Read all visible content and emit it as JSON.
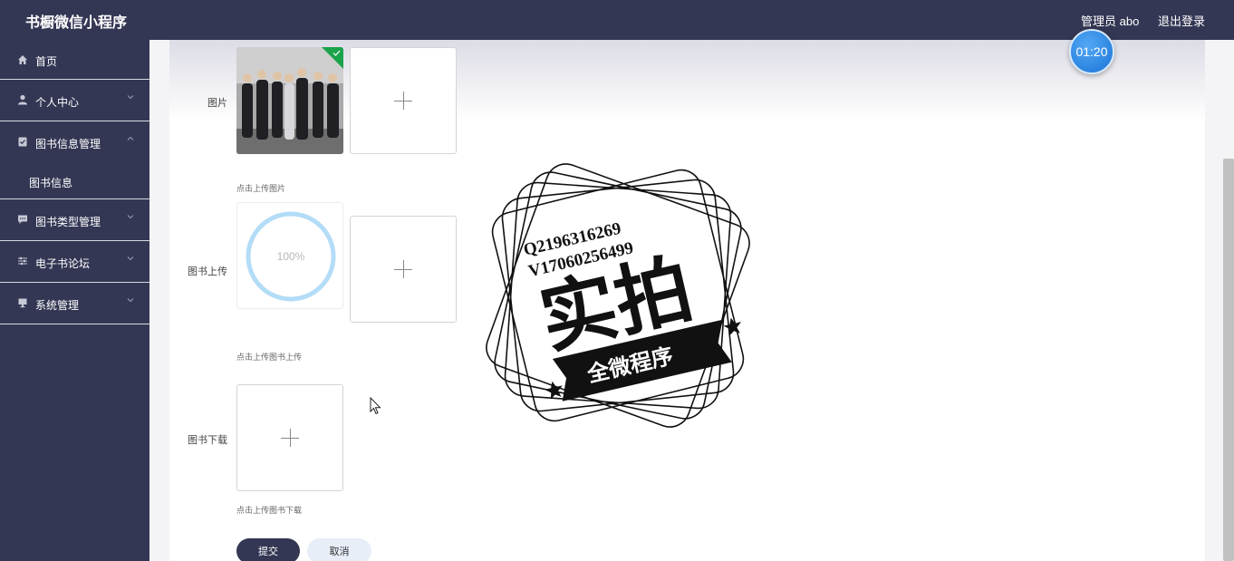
{
  "header": {
    "title": "书橱微信小程序",
    "user": "管理员 abo",
    "logout": "退出登录"
  },
  "timer": "01:20",
  "sidebar": {
    "items": [
      {
        "label": "首页",
        "icon": "home-icon"
      },
      {
        "label": "个人中心",
        "icon": "user-icon"
      },
      {
        "label": "图书信息管理",
        "icon": "clipboard-icon",
        "children": [
          {
            "label": "图书信息"
          }
        ]
      },
      {
        "label": "图书类型管理",
        "icon": "chat-icon"
      },
      {
        "label": "电子书论坛",
        "icon": "sliders-icon"
      },
      {
        "label": "系统管理",
        "icon": "desktop-icon"
      }
    ]
  },
  "form": {
    "image": {
      "label": "图片",
      "hint": "点击上传图片"
    },
    "book_upload": {
      "label": "图书上传",
      "hint": "点击上传图书上传",
      "progress": "100%"
    },
    "book_download": {
      "label": "图书下载",
      "hint": "点击上传图书下载"
    },
    "submit": "提交",
    "cancel": "取消"
  },
  "watermark": {
    "line1": "Q2196316269",
    "line2": "V17060256499",
    "main": "实拍",
    "banner": "全微程序"
  },
  "colors": {
    "header_bg": "#343754",
    "accent": "#343754",
    "progress": "#b3dcf7",
    "success": "#1ba34b"
  }
}
